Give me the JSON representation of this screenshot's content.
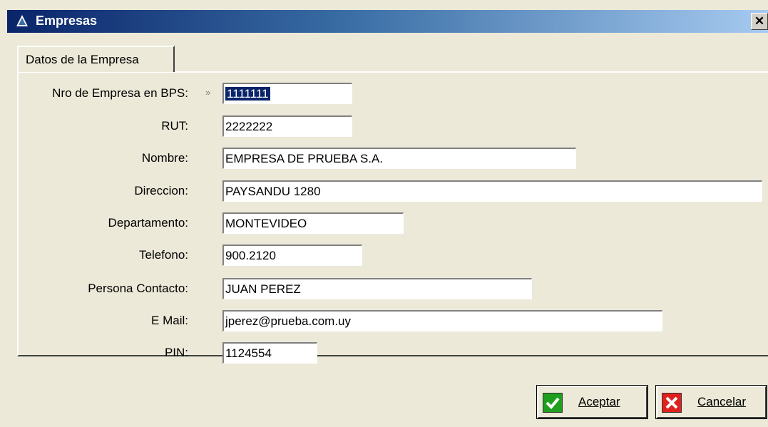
{
  "window": {
    "title": "Empresas",
    "close_glyph": "✕"
  },
  "tab": {
    "label": "Datos de la Empresa"
  },
  "form": {
    "marker": "»",
    "fields": {
      "nro_empresa": {
        "label": "Nro de Empresa en BPS:",
        "value": "1111111"
      },
      "rut": {
        "label": "RUT:",
        "value": "2222222"
      },
      "nombre": {
        "label": "Nombre:",
        "value": "EMPRESA DE PRUEBA S.A."
      },
      "direccion": {
        "label": "Direccion:",
        "value": "PAYSANDU 1280"
      },
      "departamento": {
        "label": "Departamento:",
        "value": "MONTEVIDEO"
      },
      "telefono": {
        "label": "Telefono:",
        "value": "900.2120"
      },
      "persona_contacto": {
        "label": "Persona Contacto:",
        "value": "JUAN PEREZ"
      },
      "email": {
        "label": "E Mail:",
        "value": "jperez@prueba.com.uy"
      },
      "pin": {
        "label": "PIN:",
        "value": "1124554"
      }
    }
  },
  "buttons": {
    "aceptar": {
      "label": "Aceptar",
      "icon": "check-icon",
      "color": "#1ea01e"
    },
    "cancelar": {
      "label": "Cancelar",
      "icon": "x-icon",
      "color": "#e0201c"
    }
  },
  "colors": {
    "titlebar_start": "#0a246a",
    "titlebar_end": "#a6caf0",
    "face": "#ece9d8",
    "selection": "#0a246a"
  }
}
